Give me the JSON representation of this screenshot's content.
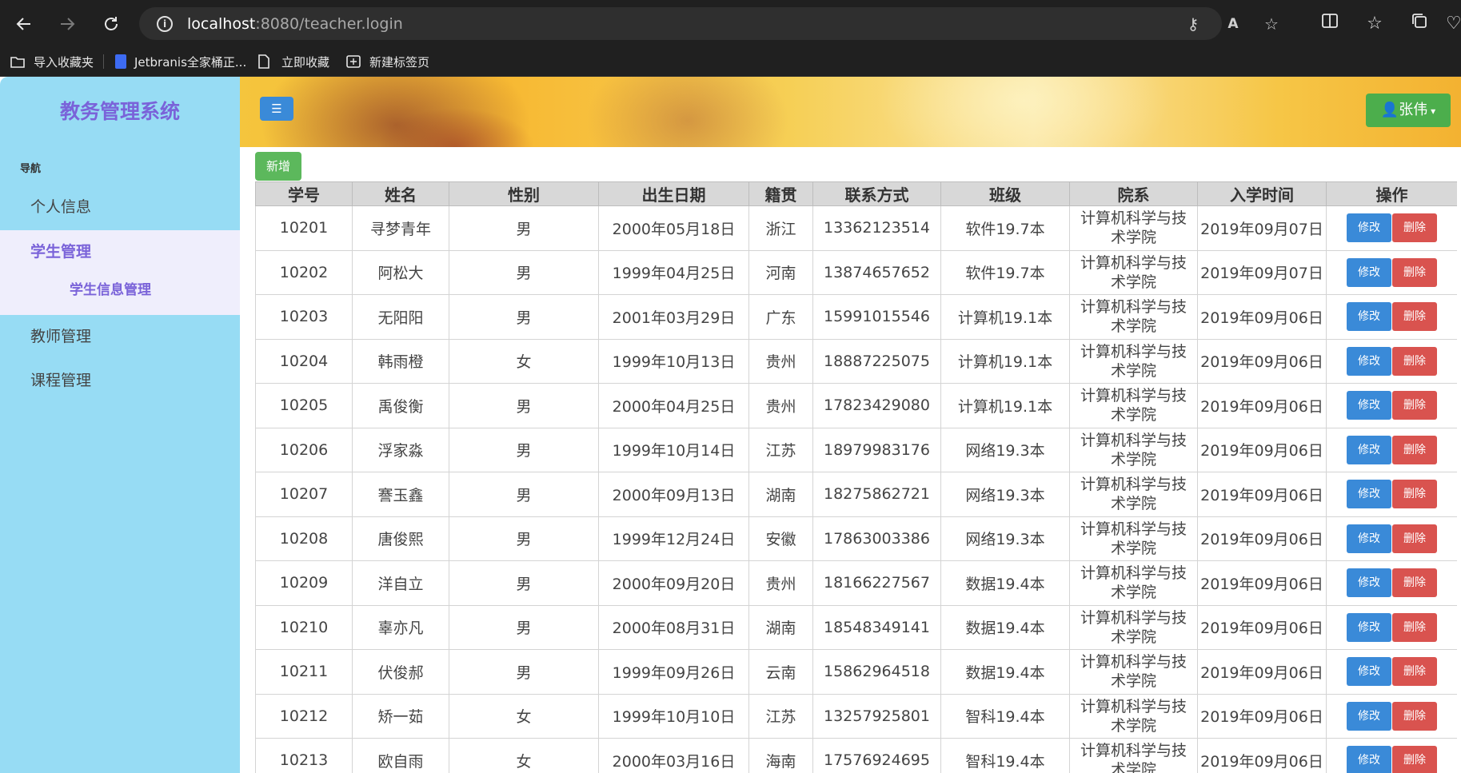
{
  "browser": {
    "url_host": "localhost",
    "url_rest": ":8080/teacher.login",
    "bookmarks": [
      "导入收藏夹",
      "Jetbranis全家桶正...",
      "立即收藏",
      "新建标签页"
    ]
  },
  "app": {
    "brand": "教务管理系统",
    "nav_header": "导航",
    "nav": {
      "personal": "个人信息",
      "student_mgmt": "学生管理",
      "student_info_mgmt": "学生信息管理",
      "teacher_mgmt": "教师管理",
      "course_mgmt": "课程管理"
    },
    "user_name": "张伟",
    "add_label": "新增"
  },
  "table": {
    "headers": [
      "学号",
      "姓名",
      "性别",
      "出生日期",
      "籍贯",
      "联系方式",
      "班级",
      "院系",
      "入学时间",
      "操作"
    ],
    "edit_label": "修改",
    "delete_label": "删除",
    "rows": [
      {
        "id": "10201",
        "name": "寻梦青年",
        "gender": "男",
        "birth": "2000年05月18日",
        "origin": "浙江",
        "phone": "13362123514",
        "cls": "软件19.7本",
        "dept": "计算机科学与技术学院",
        "enroll": "2019年09月07日"
      },
      {
        "id": "10202",
        "name": "阿松大",
        "gender": "男",
        "birth": "1999年04月25日",
        "origin": "河南",
        "phone": "13874657652",
        "cls": "软件19.7本",
        "dept": "计算机科学与技术学院",
        "enroll": "2019年09月07日"
      },
      {
        "id": "10203",
        "name": "无阳阳",
        "gender": "男",
        "birth": "2001年03月29日",
        "origin": "广东",
        "phone": "15991015546",
        "cls": "计算机19.1本",
        "dept": "计算机科学与技术学院",
        "enroll": "2019年09月06日"
      },
      {
        "id": "10204",
        "name": "韩雨橙",
        "gender": "女",
        "birth": "1999年10月13日",
        "origin": "贵州",
        "phone": "18887225075",
        "cls": "计算机19.1本",
        "dept": "计算机科学与技术学院",
        "enroll": "2019年09月06日"
      },
      {
        "id": "10205",
        "name": "禹俊衡",
        "gender": "男",
        "birth": "2000年04月25日",
        "origin": "贵州",
        "phone": "17823429080",
        "cls": "计算机19.1本",
        "dept": "计算机科学与技术学院",
        "enroll": "2019年09月06日"
      },
      {
        "id": "10206",
        "name": "浮家淼",
        "gender": "男",
        "birth": "1999年10月14日",
        "origin": "江苏",
        "phone": "18979983176",
        "cls": "网络19.3本",
        "dept": "计算机科学与技术学院",
        "enroll": "2019年09月06日"
      },
      {
        "id": "10207",
        "name": "謇玉鑫",
        "gender": "男",
        "birth": "2000年09月13日",
        "origin": "湖南",
        "phone": "18275862721",
        "cls": "网络19.3本",
        "dept": "计算机科学与技术学院",
        "enroll": "2019年09月06日"
      },
      {
        "id": "10208",
        "name": "唐俊熙",
        "gender": "男",
        "birth": "1999年12月24日",
        "origin": "安徽",
        "phone": "17863003386",
        "cls": "网络19.3本",
        "dept": "计算机科学与技术学院",
        "enroll": "2019年09月06日"
      },
      {
        "id": "10209",
        "name": "洋自立",
        "gender": "男",
        "birth": "2000年09月20日",
        "origin": "贵州",
        "phone": "18166227567",
        "cls": "数据19.4本",
        "dept": "计算机科学与技术学院",
        "enroll": "2019年09月06日"
      },
      {
        "id": "10210",
        "name": "辜亦凡",
        "gender": "男",
        "birth": "2000年08月31日",
        "origin": "湖南",
        "phone": "18548349141",
        "cls": "数据19.4本",
        "dept": "计算机科学与技术学院",
        "enroll": "2019年09月06日"
      },
      {
        "id": "10211",
        "name": "伏俊郝",
        "gender": "男",
        "birth": "1999年09月26日",
        "origin": "云南",
        "phone": "15862964518",
        "cls": "数据19.4本",
        "dept": "计算机科学与技术学院",
        "enroll": "2019年09月06日"
      },
      {
        "id": "10212",
        "name": "矫一茹",
        "gender": "女",
        "birth": "1999年10月10日",
        "origin": "江苏",
        "phone": "13257925801",
        "cls": "智科19.4本",
        "dept": "计算机科学与技术学院",
        "enroll": "2019年09月06日"
      },
      {
        "id": "10213",
        "name": "欧自雨",
        "gender": "女",
        "birth": "2000年03月16日",
        "origin": "海南",
        "phone": "17576924695",
        "cls": "智科19.4本",
        "dept": "计算机科学与技术学院",
        "enroll": "2019年09月06日"
      }
    ]
  }
}
